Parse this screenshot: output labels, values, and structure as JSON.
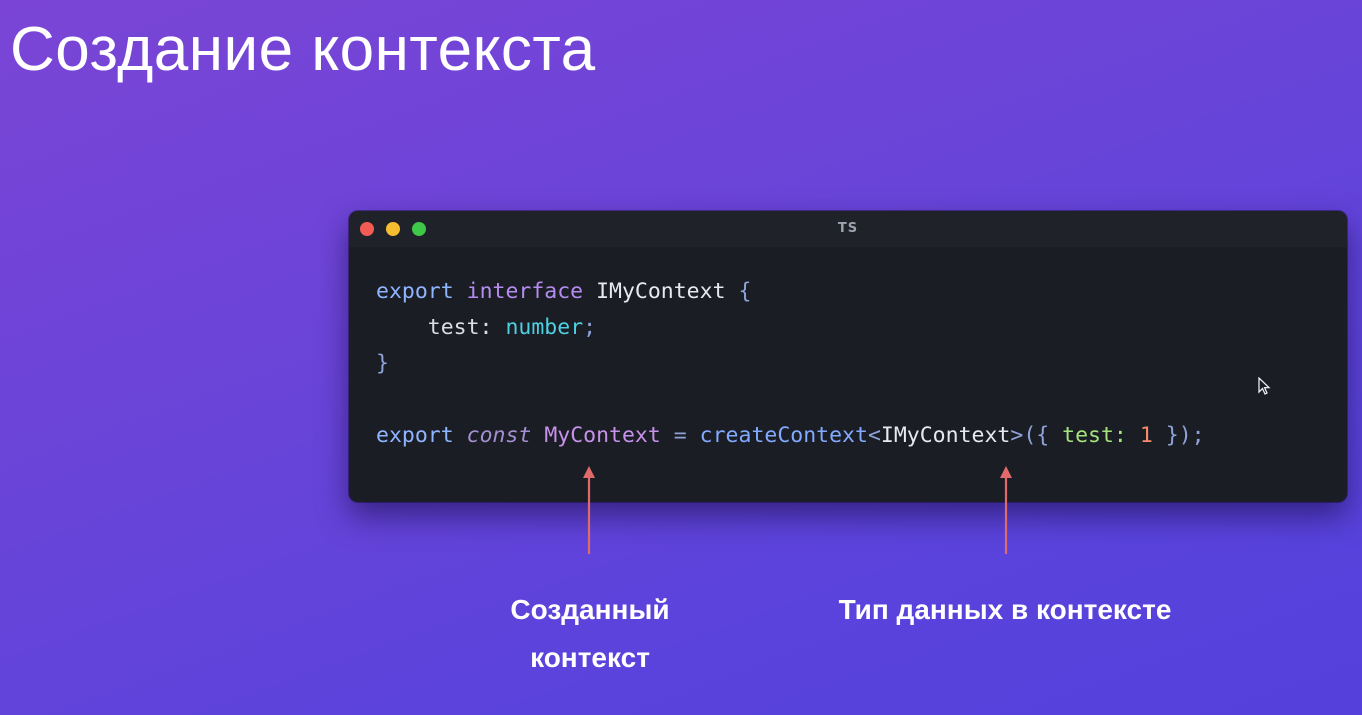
{
  "slide": {
    "title": "Создание контекста"
  },
  "window": {
    "language": "TS"
  },
  "code": {
    "l1_export": "export",
    "l1_interface": "interface",
    "l1_name": "IMyContext",
    "l1_brace": "{",
    "l2_indent": "    ",
    "l2_prop": "test:",
    "l2_type": "number",
    "l2_semi": ";",
    "l3_brace": "}",
    "l5_export": "export",
    "l5_const": "const",
    "l5_var": "MyContext",
    "l5_eq": "=",
    "l5_fn": "createContext",
    "l5_lt": "<",
    "l5_generic": "IMyContext",
    "l5_gt": ">",
    "l5_open": "({",
    "l5_key": "test:",
    "l5_value": "1",
    "l5_close": "});"
  },
  "annotations": {
    "left_caption_line1": "Созданный",
    "left_caption_line2": "контекст",
    "right_caption": "Тип данных в контексте",
    "arrow_color": "#e06a6a"
  }
}
